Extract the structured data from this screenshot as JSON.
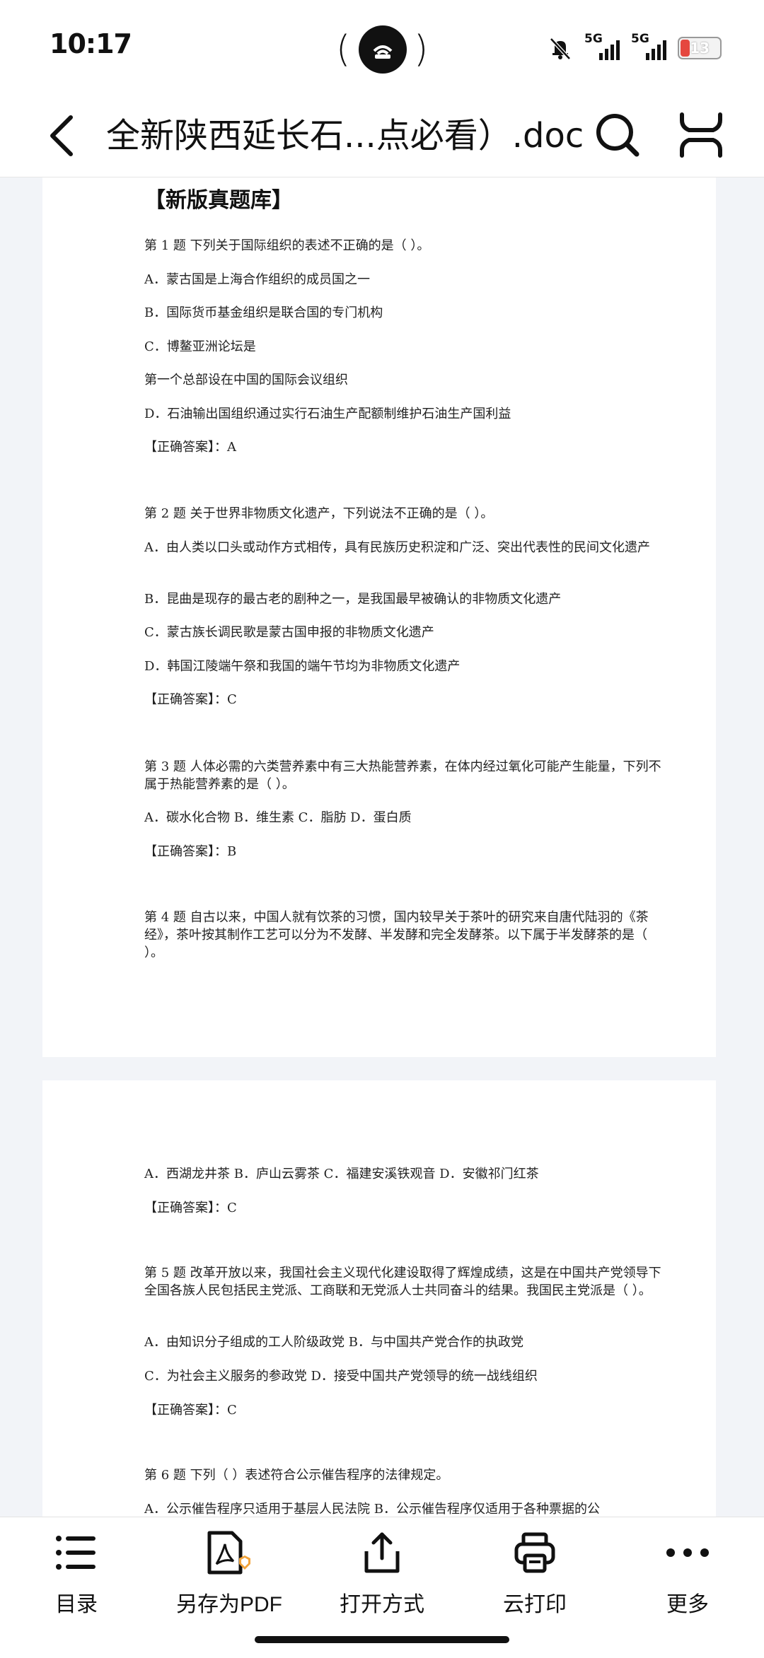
{
  "status_bar": {
    "time": "10:17",
    "signal1": "5G",
    "signal2": "5G",
    "battery": "13"
  },
  "header": {
    "title": "全新陕西延长石...点必看）.doc"
  },
  "document": {
    "heading": "【新版真题库】",
    "page1_lines": [
      "第 1 题  下列关于国际组织的表述不正确的是（        ）。",
      "A．蒙古国是上海合作组织的成员国之一",
      "B．国际货币基金组织是联合国的专门机构",
      "C．博鳌亚洲论坛是",
      "第一个总部设在中国的国际会议组织",
      "D．石油输出国组织通过实行石油生产配额制维护石油生产国利益",
      "【正确答案】：A",
      "第 2 题  关于世界非物质文化遗产，下列说法不正确的是（        ）。",
      "A．由人类以口头或动作方式相传，具有民族历史积淀和广泛、突出代表性的民间文化遗产",
      "B．昆曲是现存的最古老的剧种之一，是我国最早被确认的非物质文化遗产",
      "C．蒙古族长调民歌是蒙古国申报的非物质文化遗产",
      "D．韩国江陵端午祭和我国的端午节均为非物质文化遗产",
      "【正确答案】：C",
      "第 3 题  人体必需的六类营养素中有三大热能营养素，在体内经过氧化可能产生能量，下列不属于热能营养素的是（        ）。",
      "A．碳水化合物 B．维生素 C．脂肪 D．蛋白质",
      "【正确答案】：B",
      "第 4 题  自古以来，中国人就有饮茶的习惯，国内较早关于茶叶的研究来自唐代陆羽的《茶经》，茶叶按其制作工艺可以分为不发酵、半发酵和完全发酵茶。以下属于半发酵茶的是（        ）。"
    ],
    "page2_lines": [
      "A．西湖龙井茶 B．庐山云雾茶 C．福建安溪铁观音 D．安徽祁门红茶",
      "【正确答案】：C",
      "第 5 题  改革开放以来，我国社会主义现代化建设取得了辉煌成绩，这是在中国共产党领导下全国各族人民包括民主党派、工商联和无党派人士共同奋斗的结果。我国民主党派是（        ）。",
      "A．由知识分子组成的工人阶级政党 B．与中国共产党合作的执政党",
      "C．为社会主义服务的参政党 D．接受中国共产党领导的统一战线组织",
      "【正确答案】：C",
      "第 6 题  下列（        ）表述符合公示催告程序的法律规定。",
      "A．公示催告程序只适用于基层人民法院 B．公示催告程序仅适用于各种票据的公"
    ]
  },
  "toolbar": {
    "items": [
      {
        "label": "目录",
        "icon": "list-icon"
      },
      {
        "label": "另存为PDF",
        "icon": "pdf-icon"
      },
      {
        "label": "打开方式",
        "icon": "share-icon"
      },
      {
        "label": "云打印",
        "icon": "printer-icon"
      },
      {
        "label": "更多",
        "icon": "more-icon"
      }
    ]
  },
  "colors": {
    "battery_low": "#e5473f",
    "pdf_accent": "#f2a33a",
    "page_background": "#f2f4f8"
  }
}
